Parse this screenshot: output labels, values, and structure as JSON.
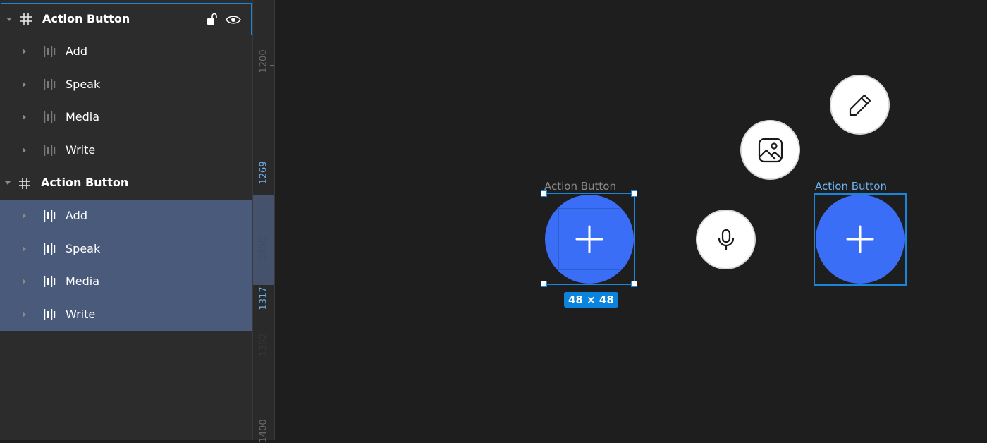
{
  "layers": {
    "groups": [
      {
        "name": "Action Button",
        "state": "selected-frame",
        "children": [
          "Add",
          "Speak",
          "Media",
          "Write"
        ]
      },
      {
        "name": "Action Button",
        "state": "children-selected",
        "children": [
          "Add",
          "Speak",
          "Media",
          "Write"
        ]
      }
    ],
    "icons": {
      "frame": "hash-icon",
      "child": "bars-icon",
      "lock": "lock-open-icon",
      "visibility": "eye-icon"
    }
  },
  "ruler": {
    "labels": [
      "1200",
      "1269",
      "1300",
      "1317",
      "1352",
      "1400"
    ]
  },
  "canvas": {
    "left_frame_label": "Action Button",
    "right_frame_label": "Action Button",
    "size_badge": "48 × 48",
    "icons": {
      "add": "plus-icon",
      "speak": "microphone-icon",
      "media": "image-icon",
      "write": "pencil-icon"
    }
  },
  "colors": {
    "accent": "#3b6ef6",
    "selection": "#1b86d9",
    "panel_bg": "#2c2c2c",
    "canvas_bg": "#1e1e1e",
    "selected_row_bg": "#4a5a7a"
  }
}
